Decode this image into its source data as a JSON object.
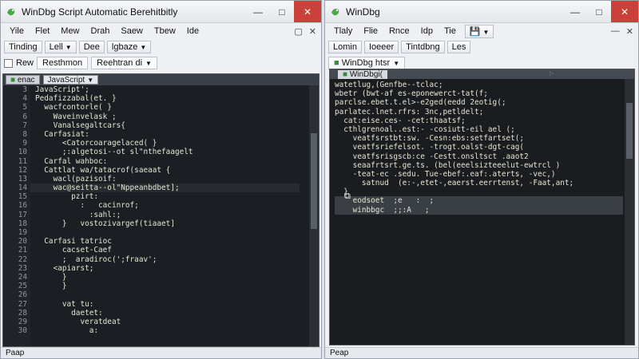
{
  "left": {
    "title": "WinDbg Script Automatic Berehitbitly",
    "menu": [
      "Yile",
      "Flet",
      "Mew",
      "Drah",
      "Saew",
      "Tbew",
      "Ide"
    ],
    "toolbar": [
      "Tinding",
      "Lell",
      "Dee",
      "lgbaze"
    ],
    "tabs_row": [
      "Rew",
      "Resthmon",
      "Reehtran di"
    ],
    "editor_tabs": [
      "enac",
      "JavaScript"
    ],
    "line_numbers": [
      "3",
      "4",
      "5",
      "6",
      "7",
      "8",
      "9",
      "10",
      "11",
      "12",
      "13",
      "14",
      "15",
      "16",
      "17",
      "18",
      "19",
      "20",
      "21",
      "22",
      "23",
      "24",
      "25",
      "26",
      "27",
      "28",
      "29",
      "30"
    ],
    "code_lines": [
      "JavaScript';",
      "Pedafizzabal(et. }",
      "  wacfcontorle( }",
      "    Waveinvelask ;",
      "    Vanalsegaltcars{",
      "  Carfasiat:",
      "      <Catorcoaragelaced( }",
      "      ;:algetosi--ot sl\"nthefaagelt",
      "  Carfal wahboc:",
      "  Cattlat wa/tatacrof(saeaat {",
      "    wacl(pazisoif:",
      "    wac@seitta--ol\"Nppeanbdbet];",
      "        pzirt:",
      "          :   cacinrof;",
      "            :sahl:;",
      "      }   vostozivargef(tiaaet]",
      "",
      "  Carfasi tatrioc",
      "      cacset-Caef",
      "      ;  aradiroc(';fraav';",
      "    <apiarst;",
      "      }",
      "      }",
      "",
      "      vat tu:",
      "        daetet:",
      "          veratdeat",
      "            a:"
    ],
    "status": "Paap"
  },
  "right": {
    "title": "WinDbg",
    "menu": [
      "Tlaly",
      "Flie",
      "Rnce",
      "Idp",
      "Tie"
    ],
    "toolbar": [
      "Lomin",
      "Ioeeer",
      "Tintdbng",
      "Les"
    ],
    "selector": "WinDbg htsr",
    "editor_tab": "WinDbgi(",
    "code_lines": [
      "watetlug,(Genfbe--tclac;",
      "wbetr (bwt-af es-eponewerct-tat(f;",
      "parclse.ebet.t.el>-e2ged(eedd 2eotig(;",
      "parlatec.lnet.rfrs: 3nc,petldelt;",
      "  cat:eise.ces- -cet:thaatsf;",
      "  cthlgrenoal..est:- -cosiutt-eil ael (;",
      "    veatfsrstbt:sw. -Cesn:ebs:setfartset(;",
      "    veatfsriefelsot. -trogt.oalst-dgt-cag(",
      "    veatfsrisgscb:ce -Cestt.onsltsct .aaot2",
      "    seaafrtsrt.ge.ts. (bel(eeelsizteeelut-ewtrcl )",
      "    -teat-ec .sedu. Tue-ebef:.eaf:.aterts, -vec,)",
      "      satnud  (e:-,etet-,eaerst.eerrtenst, -Faat,ant;",
      "  }",
      "    eodsoet  ;e   :  ;",
      "    winbbgc  ;;:A   ;"
    ],
    "status": "Peap"
  }
}
